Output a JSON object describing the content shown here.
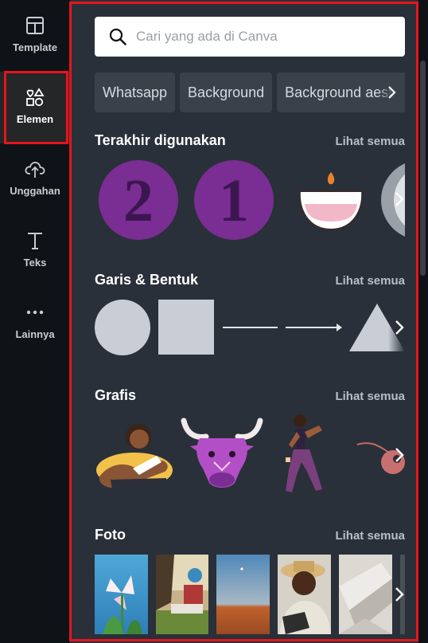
{
  "nav": {
    "items": [
      {
        "id": "template",
        "label": "Template",
        "icon": "template-icon"
      },
      {
        "id": "elemen",
        "label": "Elemen",
        "icon": "elements-icon"
      },
      {
        "id": "unggahan",
        "label": "Unggahan",
        "icon": "upload-cloud-icon"
      },
      {
        "id": "teks",
        "label": "Teks",
        "icon": "text-icon"
      },
      {
        "id": "lainnya",
        "label": "Lainnya",
        "icon": "more-dots-icon"
      }
    ],
    "active": "elemen"
  },
  "search": {
    "placeholder": "Cari yang ada di Canva"
  },
  "chips": [
    "Whatsapp",
    "Background",
    "Background aesthetic"
  ],
  "sections": {
    "recent": {
      "title": "Terakhir digunakan",
      "link": "Lihat semua",
      "items": [
        "2",
        "1"
      ]
    },
    "shapes": {
      "title": "Garis & Bentuk",
      "link": "Lihat semua"
    },
    "graphics": {
      "title": "Grafis",
      "link": "Lihat semua"
    },
    "photos": {
      "title": "Foto",
      "link": "Lihat semua"
    }
  },
  "colors": {
    "highlight": "#e8141c",
    "panel": "#293039",
    "purple": "#7a2d92",
    "shape": "#c8cdd6"
  }
}
